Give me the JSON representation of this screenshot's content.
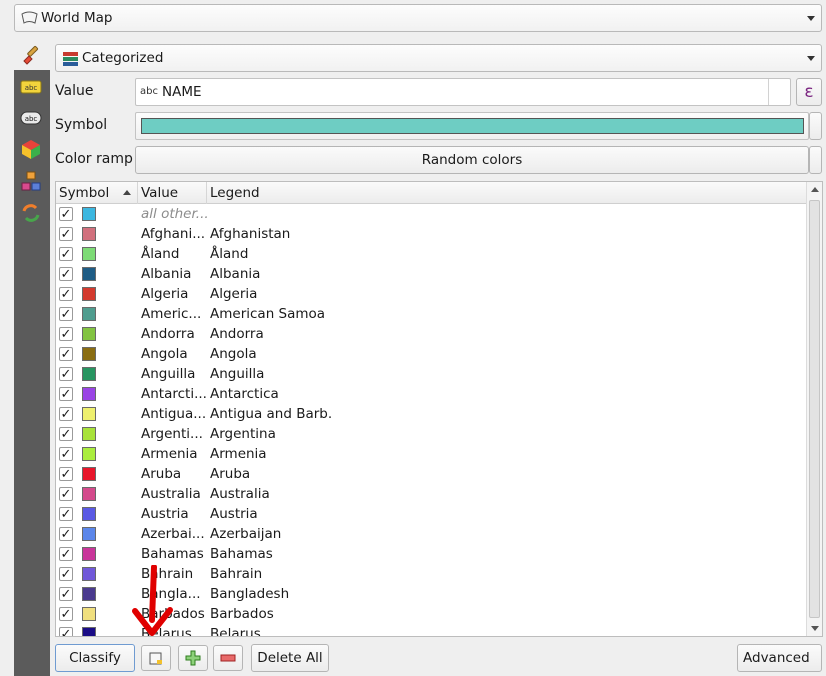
{
  "layer": {
    "name": "World Map"
  },
  "renderer": {
    "type": "Categorized"
  },
  "value": {
    "label": "Value",
    "field": "NAME",
    "field_type": "abc",
    "expr_button": "ε"
  },
  "symbol": {
    "label": "Symbol",
    "color": "#6ecdc3"
  },
  "color_ramp": {
    "label": "Color ramp",
    "value": "Random colors"
  },
  "table": {
    "headers": {
      "symbol": "Symbol",
      "value": "Value",
      "legend": "Legend"
    },
    "rows": [
      {
        "checked": "✓",
        "color": "#3cb7e0",
        "value": "all other...",
        "legend": ""
      },
      {
        "checked": "✓",
        "color": "#d1707d",
        "value": "Afghani...",
        "legend": "Afghanistan"
      },
      {
        "checked": "✓",
        "color": "#7ddb76",
        "value": "Åland",
        "legend": "Åland"
      },
      {
        "checked": "✓",
        "color": "#1e5c85",
        "value": "Albania",
        "legend": "Albania"
      },
      {
        "checked": "✓",
        "color": "#d33a2e",
        "value": "Algeria",
        "legend": "Algeria"
      },
      {
        "checked": "✓",
        "color": "#4f9d8f",
        "value": "Americ...",
        "legend": "American Samoa"
      },
      {
        "checked": "✓",
        "color": "#82c341",
        "value": "Andorra",
        "legend": "Andorra"
      },
      {
        "checked": "✓",
        "color": "#8a6d12",
        "value": "Angola",
        "legend": "Angola"
      },
      {
        "checked": "✓",
        "color": "#279561",
        "value": "Anguilla",
        "legend": "Anguilla"
      },
      {
        "checked": "✓",
        "color": "#9a44e5",
        "value": "Antarcti...",
        "legend": "Antarctica"
      },
      {
        "checked": "✓",
        "color": "#eef06e",
        "value": "Antigua...",
        "legend": "Antigua and Barb."
      },
      {
        "checked": "✓",
        "color": "#a8e23a",
        "value": "Argenti...",
        "legend": "Argentina"
      },
      {
        "checked": "✓",
        "color": "#aaed3e",
        "value": "Armenia",
        "legend": "Armenia"
      },
      {
        "checked": "✓",
        "color": "#e8162b",
        "value": "Aruba",
        "legend": "Aruba"
      },
      {
        "checked": "✓",
        "color": "#d44a8c",
        "value": "Australia",
        "legend": "Australia"
      },
      {
        "checked": "✓",
        "color": "#5a59e4",
        "value": "Austria",
        "legend": "Austria"
      },
      {
        "checked": "✓",
        "color": "#5b86ea",
        "value": "Azerbai...",
        "legend": "Azerbaijan"
      },
      {
        "checked": "✓",
        "color": "#c9359a",
        "value": "Bahamas",
        "legend": "Bahamas"
      },
      {
        "checked": "✓",
        "color": "#7058d9",
        "value": "Bahrain",
        "legend": "Bahrain"
      },
      {
        "checked": "✓",
        "color": "#4a3a8e",
        "value": "Bangla...",
        "legend": "Bangladesh"
      },
      {
        "checked": "✓",
        "color": "#f0df7e",
        "value": "Barbados",
        "legend": "Barbados"
      },
      {
        "checked": "✓",
        "color": "#1a0c86",
        "value": "Belarus",
        "legend": "Belarus"
      }
    ]
  },
  "toolbar": {
    "classify": "Classify",
    "delete_all": "Delete All",
    "advanced": "Advanced"
  },
  "colors": {
    "sidebar": "#5b5b5b",
    "annotation_arrow": "#e00000"
  }
}
